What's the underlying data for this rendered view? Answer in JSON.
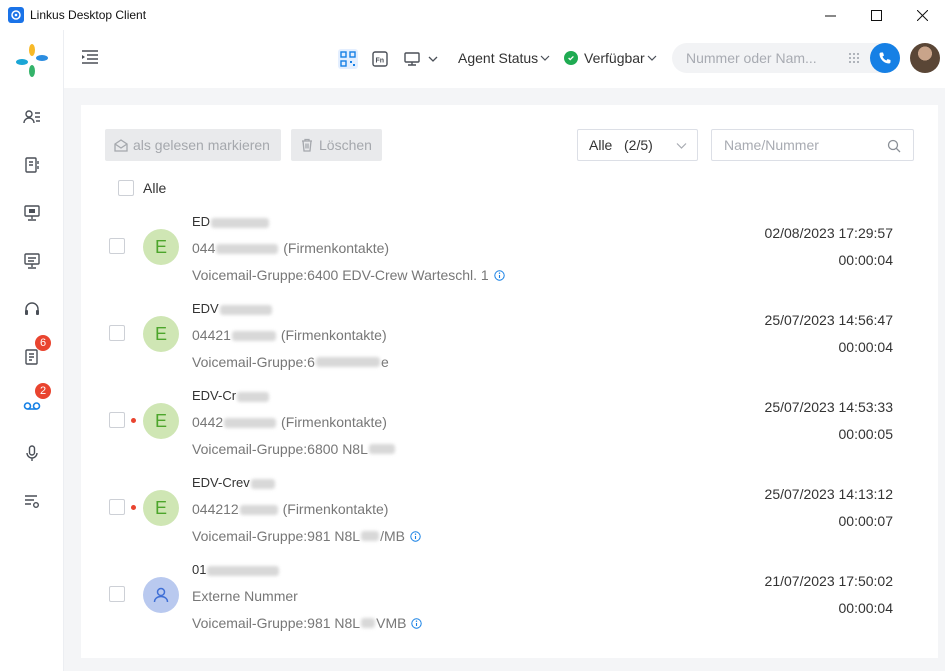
{
  "window": {
    "title": "Linkus Desktop Client"
  },
  "topbar": {
    "agent_status_label": "Agent Status",
    "availability_label": "Verfügbar",
    "dial_placeholder": "Nummer oder Nam..."
  },
  "sidebar": {
    "badges": {
      "calls": "6",
      "voicemail": "2"
    }
  },
  "toolbar": {
    "mark_read_label": "als gelesen markieren",
    "delete_label": "Löschen",
    "filter_label": "Alle   (2/5)",
    "search_placeholder": "Name/Nummer"
  },
  "list": {
    "select_all_label": "Alle",
    "rows": [
      {
        "name": "ED",
        "avatar_letter": "E",
        "number": "044",
        "source": "(Firmenkontakte)",
        "group": "Voicemail-Gruppe:6400 EDV-Crew Warteschl. 1",
        "datetime": "02/08/2023 17:29:57",
        "duration": "00:00:04"
      },
      {
        "name": "EDV",
        "avatar_letter": "E",
        "number": "04421",
        "source": "(Firmenkontakte)",
        "group": "Voicemail-Gruppe:6",
        "group_tail": "e",
        "datetime": "25/07/2023 14:56:47",
        "duration": "00:00:04"
      },
      {
        "name": "EDV-Cr",
        "avatar_letter": "E",
        "number": "0442",
        "source": "(Firmenkontakte)",
        "group": "Voicemail-Gruppe:6800 N8L",
        "datetime": "25/07/2023 14:53:33",
        "duration": "00:00:05"
      },
      {
        "name": "EDV-Crev",
        "avatar_letter": "E",
        "number": "044212",
        "source": "(Firmenkontakte)",
        "group": "Voicemail-Gruppe:981 N8L",
        "group_tail": "/MB",
        "datetime": "25/07/2023 14:13:12",
        "duration": "00:00:07"
      },
      {
        "name": "01",
        "number": "Externe Nummer",
        "group": "Voicemail-Gruppe:981 N8L",
        "group_tail": "VMB",
        "datetime": "21/07/2023 17:50:02",
        "duration": "00:00:04"
      }
    ]
  }
}
